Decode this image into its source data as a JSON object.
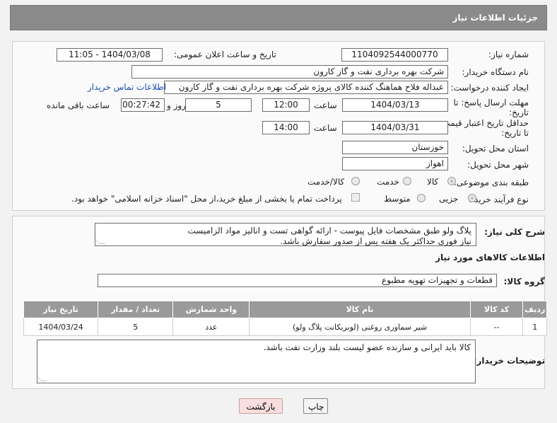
{
  "header": {
    "title": "جزئیات اطلاعات نیاز"
  },
  "form": {
    "need_number_label": "شماره نیاز:",
    "need_number": "1104092544000770",
    "announce_label": "تاریخ و ساعت اعلان عمومی:",
    "announce_value": "1404/03/08 - 11:05",
    "buyer_org_label": "نام دستگاه خریدار:",
    "buyer_org": "شرکت بهره برداری نفت و گاز کارون",
    "requester_label": "ایجاد کننده درخواست:",
    "requester": "عبداله فلاح هماهنگ کننده کالای پروژه شرکت بهره برداری نفت و گاز کارون",
    "contact_link": "اطلاعات تماس خریدار",
    "deadline_label_1": "مهلت ارسال پاسخ: تا",
    "deadline_label_2": "تاریخ:",
    "deadline_date": "1404/03/13",
    "hour_label": "ساعت",
    "deadline_time": "12:00",
    "days_value": "5",
    "days_label": "روز و",
    "remaining_value": "00:27:42",
    "remaining_label": "ساعت باقی مانده",
    "validity_label_1": "حداقل تاریخ اعتبار قیمت:",
    "validity_label_2": "تا تاریخ:",
    "validity_date": "1404/03/31",
    "validity_time": "14:00",
    "province_label": "استان محل تحویل:",
    "province": "خوزستان",
    "city_label": "شهر محل تحویل:",
    "city": "اهواز",
    "category_label": "طبقه بندی موضوعی:",
    "category_options": [
      "کالا",
      "خدمت",
      "کالا/خدمت"
    ],
    "process_label": "نوع فرآیند خرید :",
    "process_options": [
      "جزیی",
      "متوسط"
    ],
    "payment_note": "پرداخت تمام یا بخشی از مبلغ خرید،از محل \"اسناد خزانه اسلامی\" خواهد بود."
  },
  "details": {
    "desc_label": "شرح کلی نیاز:",
    "desc_line1": "پلاگ ولو طبق مشخصات فایل پیوست - ارائه گواهی تست و انالیز مواد الزامیست",
    "desc_line2": "نیاز فوری حداکثر یک هفته پس از صدور سفارش باشد.",
    "goods_info_title": "اطلاعات کالاهای مورد نیاز",
    "goods_group_label": "گروه کالا:",
    "goods_group": "قطعات و تجهیزات تهویه مطبوع",
    "table": {
      "headers": [
        "ردیف",
        "کد کالا",
        "نام کالا",
        "واحد شمارش",
        "تعداد / مقدار",
        "تاریخ نیاز"
      ],
      "rows": [
        [
          "1",
          "--",
          "شیر سماوری روغنی (لوبریکانت پلاگ ولو)",
          "عدد",
          "5",
          "1404/03/24"
        ]
      ]
    },
    "buyer_notes_label": "توضیحات خریدار:",
    "buyer_notes": "کالا باید ایرانی و سازنده عضو لیست بلند وزارت نفت باشد."
  },
  "buttons": {
    "print": "چاپ",
    "back": "بازگشت"
  },
  "colors": {
    "header_bg": "#8a8a8a",
    "table_header_bg": "#9a9a9a",
    "link": "#1a4fb8",
    "back_btn": "#f8dede"
  }
}
